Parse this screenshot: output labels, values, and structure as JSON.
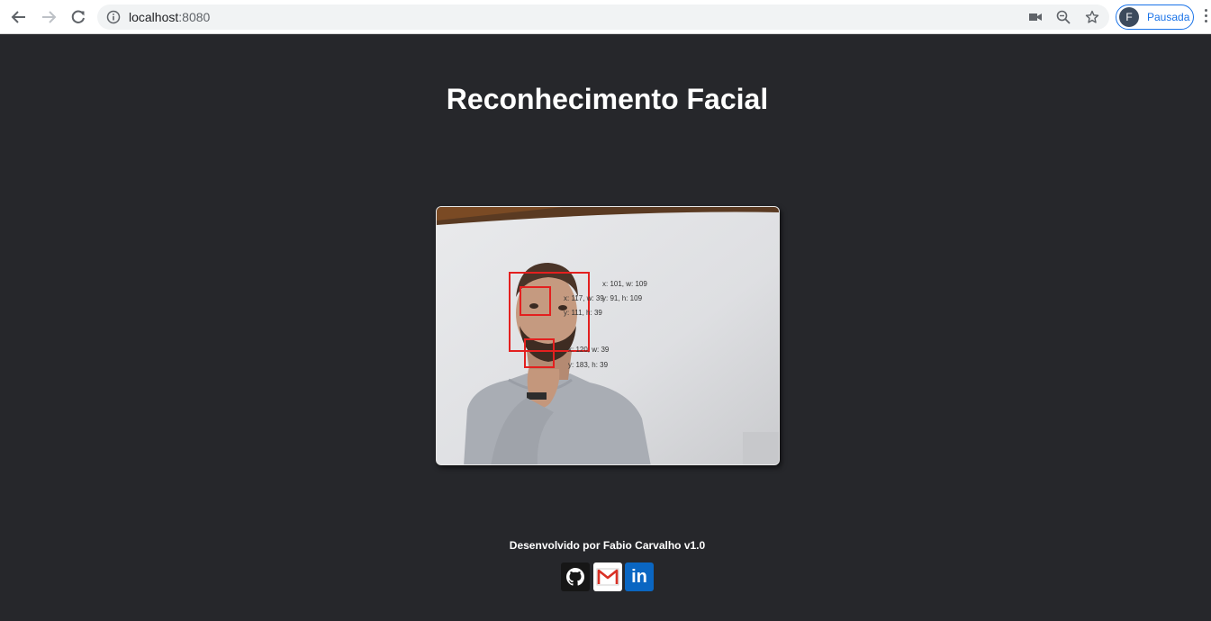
{
  "browser": {
    "url_host": "localhost",
    "url_port": ":8080",
    "profile_initial": "F",
    "profile_label": "Pausada",
    "icons": [
      "back-icon",
      "forward-icon",
      "reload-icon",
      "info-icon",
      "camera-icon",
      "zoom-icon",
      "star-icon",
      "menu-icon"
    ]
  },
  "page": {
    "title": "Reconhecimento Facial"
  },
  "video": {
    "labels": {
      "face_x_w": "x: 101, w: 109",
      "face_y_h": "y: 91, h: 109",
      "eye_x_w": "x: 117, w: 39",
      "eye_y_h": "y: 111, h: 39",
      "mouth_x_w": "x: 120, w: 39",
      "mouth_y_h": "y: 183, h: 39"
    }
  },
  "footer": {
    "credit": "Desenvolvido por Fabio Carvalho v1.0",
    "social": [
      "github-icon",
      "gmail-icon",
      "linkedin-icon"
    ],
    "linkedin_text": "in"
  },
  "colors": {
    "background": "#26272b",
    "detection": "#e3201f",
    "linkedin": "#0a66c2",
    "profile_accent": "#1a73e8"
  }
}
